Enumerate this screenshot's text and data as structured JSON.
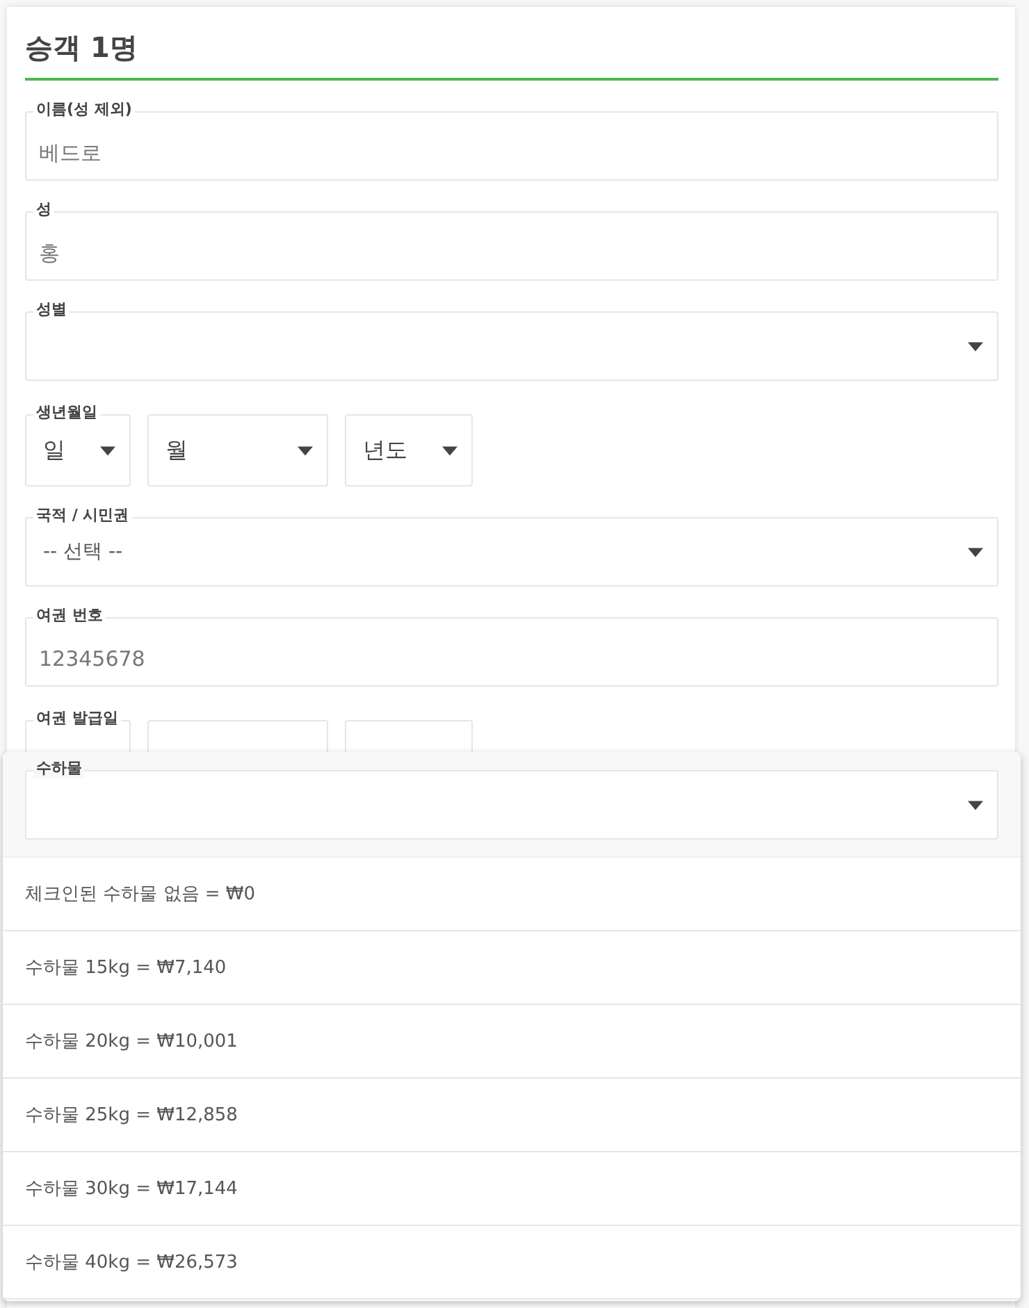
{
  "heading": "승객 1명",
  "fields": [
    {
      "kind": "text",
      "label": "이름(성 제외)",
      "placeholder": "베드로"
    },
    {
      "kind": "text",
      "label": "성",
      "placeholder": "홍"
    },
    {
      "kind": "select",
      "label": "성별"
    },
    {
      "kind": "date",
      "label": "생년월일",
      "parts": [
        "일",
        "월",
        "년도"
      ]
    },
    {
      "kind": "select",
      "label": "국적 / 시민권",
      "value": "-- 선택 --"
    },
    {
      "kind": "text",
      "label": "여권 번호",
      "placeholder": "12345678"
    },
    {
      "kind": "date",
      "label": "여권 발급일"
    }
  ],
  "baggage_dropdown": {
    "label": "수하물",
    "options": [
      {
        "label": "체크인된 수하물 없음 = ₩0",
        "selected": false
      },
      {
        "label": "수하물 15kg = ₩7,140",
        "selected": false
      },
      {
        "label": "수하물 20kg = ₩10,001",
        "selected": false
      },
      {
        "label": "수하물 25kg = ₩12,858",
        "selected": false
      },
      {
        "label": "수하물 30kg = ₩17,144",
        "selected": false
      },
      {
        "label": "수하물 40kg = ₩26,573",
        "selected": false
      }
    ]
  }
}
